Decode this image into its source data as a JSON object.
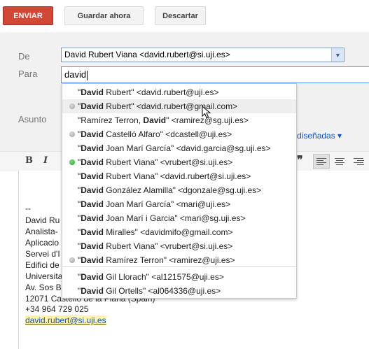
{
  "toolbar": {
    "send_label": "ENVIAR",
    "save_label": "Guardar ahora",
    "discard_label": "Descartar",
    "send_color": "#d14836"
  },
  "compose": {
    "from_label": "De",
    "from_value": "David Rubert Viana <david.rubert@si.uji.es>",
    "to_label": "Para",
    "to_value": "david",
    "subject_label": "Asunto",
    "rich_format_link": "diseñadas ▾"
  },
  "autocomplete": {
    "query": "David",
    "items": [
      {
        "pre": "\"",
        "bold": "David",
        "rest": " Rubert\" <david.rubert@uji.es>",
        "dot": "none"
      },
      {
        "pre": "\"",
        "bold": "David",
        "rest": " Rubert\" <david.rubert@gmail.com>",
        "dot": "gray"
      },
      {
        "pre": "\"Ramírez Terron, ",
        "bold": "David",
        "rest": "\" <ramirez@sg.uji.es>",
        "dot": "none"
      },
      {
        "pre": "\"",
        "bold": "David",
        "rest": " Castelló Alfaro\" <dcastell@uji.es>",
        "dot": "gray"
      },
      {
        "pre": "\"",
        "bold": "David",
        "rest": " Joan Marí García\" <david.garcia@sg.uji.es>",
        "dot": "none"
      },
      {
        "pre": "\"",
        "bold": "David",
        "rest": " Rubert Viana\" <vrubert@si.uji.es>",
        "dot": "green"
      },
      {
        "pre": "\"",
        "bold": "David",
        "rest": " Rubert Viana\" <david.rubert@si.uji.es>",
        "dot": "none"
      },
      {
        "pre": "\"",
        "bold": "David",
        "rest": " González Alamilla\" <dgonzale@sg.uji.es>",
        "dot": "none"
      },
      {
        "pre": "\"",
        "bold": "David",
        "rest": " Joan Marí García\" <mari@uji.es>",
        "dot": "none"
      },
      {
        "pre": "\"",
        "bold": "David",
        "rest": " Joan Marí i Garcia\" <mari@sg.uji.es>",
        "dot": "none"
      },
      {
        "pre": "\"",
        "bold": "David",
        "rest": " Miralles\" <davidmifo@gmail.com>",
        "dot": "none"
      },
      {
        "pre": "\"",
        "bold": "David",
        "rest": " Rubert Viana\" <vrubert@si.uji.es>",
        "dot": "none"
      },
      {
        "pre": "\"",
        "bold": "David",
        "rest": " Ramírez Terron\" <ramirez@uji.es>",
        "dot": "gray"
      },
      {
        "pre": "\"",
        "bold": "David",
        "rest": " Gil Llorach\" <al121575@uji.es>",
        "dot": "none"
      },
      {
        "pre": "\"",
        "bold": "David",
        "rest": " Gil Ortells\" <al064336@uji.es>",
        "dot": "none"
      }
    ]
  },
  "signature": {
    "dash": "--",
    "line1": "David Ru",
    "line2": "Analista-",
    "line3": "Aplicacio",
    "line4": "Servei d'I",
    "line5": "Edifici de",
    "line6": "Universita",
    "line7": "Av. Sos B",
    "line8": "12071 Castelló de la Plana (Spain)",
    "phone": "+34 964 729 025",
    "email_link": "david.rubert@si.uji.es"
  },
  "colors": {
    "accent": "#d14836",
    "link": "#1155cc",
    "presence_online": "#1ea21e"
  }
}
